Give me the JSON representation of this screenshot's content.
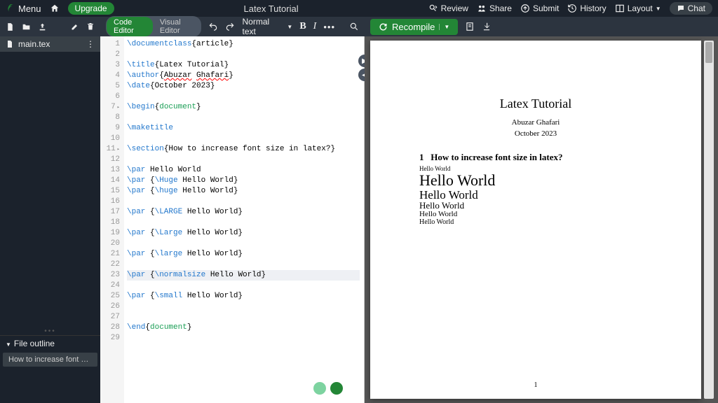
{
  "top": {
    "menu": "Menu",
    "upgrade": "Upgrade",
    "title": "Latex Tutorial",
    "review": "Review",
    "share": "Share",
    "submit": "Submit",
    "history": "History",
    "layout": "Layout",
    "chat": "Chat"
  },
  "toolbar": {
    "code_editor": "Code Editor",
    "visual_editor": "Visual Editor",
    "format": "Normal text",
    "recompile": "Recompile"
  },
  "filetree": {
    "file": "main.tex",
    "outline_hdr": "File outline",
    "outline_item": "How to increase font siz..."
  },
  "code": {
    "lines": [
      [
        {
          "t": "cmd",
          "v": "\\documentclass"
        },
        {
          "t": "",
          "v": "{article}"
        }
      ],
      [],
      [
        {
          "t": "cmd",
          "v": "\\title"
        },
        {
          "t": "",
          "v": "{Latex Tutorial}"
        }
      ],
      [
        {
          "t": "cmd",
          "v": "\\author"
        },
        {
          "t": "",
          "v": "{"
        },
        {
          "t": "wavy",
          "v": "Abuzar"
        },
        {
          "t": "",
          "v": " "
        },
        {
          "t": "wavy",
          "v": "Ghafari"
        },
        {
          "t": "",
          "v": "}"
        }
      ],
      [
        {
          "t": "cmd",
          "v": "\\date"
        },
        {
          "t": "",
          "v": "{October 2023}"
        }
      ],
      [],
      [
        {
          "t": "cmd",
          "v": "\\begin"
        },
        {
          "t": "",
          "v": "{"
        },
        {
          "t": "kw",
          "v": "document"
        },
        {
          "t": "",
          "v": "}"
        }
      ],
      [],
      [
        {
          "t": "cmd",
          "v": "\\maketitle"
        }
      ],
      [],
      [
        {
          "t": "cmd",
          "v": "\\section"
        },
        {
          "t": "",
          "v": "{How to increase font size in latex?}"
        }
      ],
      [],
      [
        {
          "t": "cmd",
          "v": "\\par"
        },
        {
          "t": "",
          "v": " Hello World"
        }
      ],
      [
        {
          "t": "cmd",
          "v": "\\par"
        },
        {
          "t": "",
          "v": " {"
        },
        {
          "t": "cmd",
          "v": "\\Huge"
        },
        {
          "t": "",
          "v": " Hello World}"
        }
      ],
      [
        {
          "t": "cmd",
          "v": "\\par"
        },
        {
          "t": "",
          "v": " {"
        },
        {
          "t": "cmd",
          "v": "\\huge"
        },
        {
          "t": "",
          "v": " Hello World}"
        }
      ],
      [],
      [
        {
          "t": "cmd",
          "v": "\\par"
        },
        {
          "t": "",
          "v": " {"
        },
        {
          "t": "cmd",
          "v": "\\LARGE"
        },
        {
          "t": "",
          "v": " Hello World}"
        }
      ],
      [],
      [
        {
          "t": "cmd",
          "v": "\\par"
        },
        {
          "t": "",
          "v": " {"
        },
        {
          "t": "cmd",
          "v": "\\Large"
        },
        {
          "t": "",
          "v": " Hello World}"
        }
      ],
      [],
      [
        {
          "t": "cmd",
          "v": "\\par"
        },
        {
          "t": "",
          "v": " {"
        },
        {
          "t": "cmd",
          "v": "\\large"
        },
        {
          "t": "",
          "v": " Hello World}"
        }
      ],
      [],
      [
        {
          "t": "cmd",
          "v": "\\par"
        },
        {
          "t": "",
          "v": " {"
        },
        {
          "t": "cmd",
          "v": "\\normalsize"
        },
        {
          "t": "",
          "v": " Hello World}"
        }
      ],
      [],
      [
        {
          "t": "cmd",
          "v": "\\par"
        },
        {
          "t": "",
          "v": " {"
        },
        {
          "t": "cmd",
          "v": "\\small"
        },
        {
          "t": "",
          "v": " Hello World}"
        }
      ],
      [],
      [],
      [
        {
          "t": "cmd",
          "v": "\\end"
        },
        {
          "t": "",
          "v": "{"
        },
        {
          "t": "kw",
          "v": "document"
        },
        {
          "t": "",
          "v": "}"
        }
      ],
      []
    ],
    "highlight_index": 22,
    "fold_lines": [
      6,
      10
    ]
  },
  "pdf": {
    "title": "Latex Tutorial",
    "author": "Abuzar Ghafari",
    "date": "October 2023",
    "sec_num": "1",
    "sec_title": "How to increase font size in latex?",
    "lines": [
      {
        "text": "Hello World",
        "size": 9
      },
      {
        "text": "Hello World",
        "size": 22
      },
      {
        "text": "Hello World",
        "size": 17
      },
      {
        "text": "Hello World",
        "size": 13
      },
      {
        "text": "Hello World",
        "size": 11
      },
      {
        "text": "Hello World",
        "size": 10
      }
    ],
    "page": "1"
  }
}
